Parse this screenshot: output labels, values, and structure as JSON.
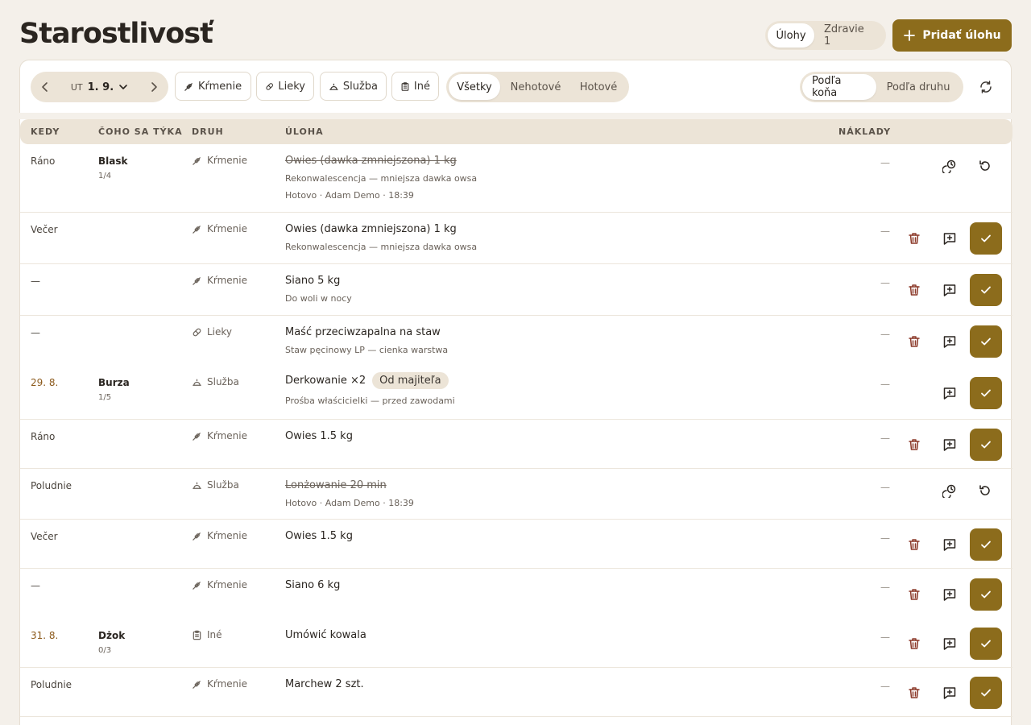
{
  "page": {
    "title": "Starostlivosť",
    "view_tabs": [
      "Úlohy",
      "Zdravie 1"
    ],
    "add_button": "Pridať úlohu"
  },
  "toolbar": {
    "day_of_week": "UT",
    "date": "1. 9.",
    "categories": [
      "Kŕmenie",
      "Lieky",
      "Služba",
      "Iné"
    ],
    "status_filters": [
      "Všetky",
      "Nehotové",
      "Hotové"
    ],
    "sort_options": [
      "Podľa koňa",
      "Podľa druhu"
    ]
  },
  "columns": [
    "KEDY",
    "ČOHO SA TÝKA",
    "DRUH",
    "ÚLOHA",
    "NÁKLADY"
  ],
  "rows": [
    {
      "when": "Ráno",
      "horse": "Blask",
      "horse_sub": "1/4",
      "kind": "Kŕmenie",
      "task": "Owies (dawka zmniejszona) 1 kg",
      "note": "Rekonwalescencja — mniejsza dawka owsa",
      "meta": "Hotovo · Adam Demo · 18:39",
      "cost": "—"
    },
    {
      "when": "Večer",
      "kind": "Kŕmenie",
      "task": "Owies (dawka zmniejszona) 1 kg",
      "note": "Rekonwalescencja — mniejsza dawka owsa",
      "cost": "—"
    },
    {
      "when": "—",
      "kind": "Kŕmenie",
      "task": "Siano 5 kg",
      "note": "Do woli w nocy",
      "cost": "—"
    },
    {
      "when": "—",
      "kind": "Lieky",
      "task": "Maść przeciwzapalna na staw",
      "note": "Staw pęcinowy LP — cienka warstwa",
      "cost": "—"
    },
    {
      "when": "29. 8.",
      "horse": "Burza",
      "horse_sub": "1/5",
      "kind": "Služba",
      "task": "Derkowanie ×2",
      "badge": "Od majiteľa",
      "note": "Prośba właścicielki — przed zawodami",
      "cost": "—"
    },
    {
      "when": "Ráno",
      "kind": "Kŕmenie",
      "task": "Owies 1.5 kg",
      "cost": "—"
    },
    {
      "when": "Poludnie",
      "kind": "Služba",
      "task": "Lonżowanie 20 min",
      "meta": "Hotovo · Adam Demo · 18:39",
      "cost": "—"
    },
    {
      "when": "Večer",
      "kind": "Kŕmenie",
      "task": "Owies 1.5 kg",
      "cost": "—"
    },
    {
      "when": "—",
      "kind": "Kŕmenie",
      "task": "Siano 6 kg",
      "cost": "—"
    },
    {
      "when": "31. 8.",
      "horse": "Dżok",
      "horse_sub": "0/3",
      "kind": "Iné",
      "task": "Umówić kowala",
      "cost": "—"
    },
    {
      "when": "Poludnie",
      "kind": "Kŕmenie",
      "task": "Marchew 2 szt.",
      "cost": "—"
    }
  ],
  "colors": {
    "accent": "#8c6c1c",
    "background": "#f4f0ea",
    "header_bg": "#ece4d7",
    "date_text": "#8c5a1c",
    "trash": "#8c3a2a"
  }
}
